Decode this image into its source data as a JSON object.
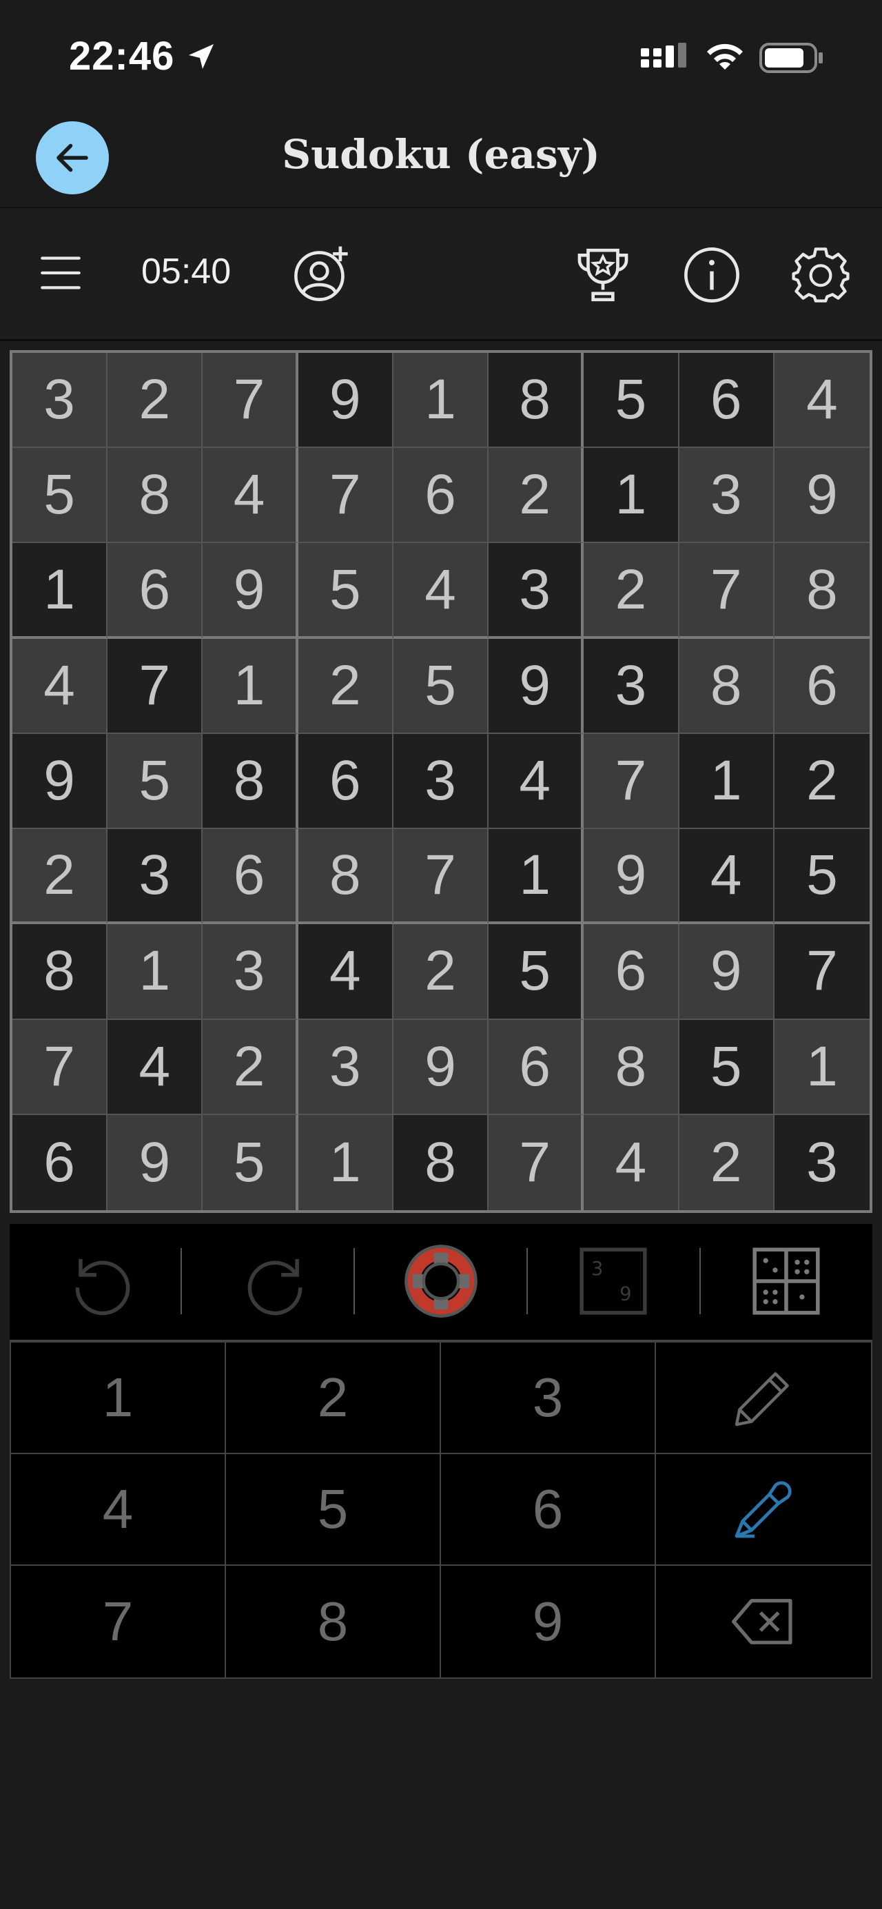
{
  "status": {
    "time": "22:46"
  },
  "header": {
    "title": "Sudoku (easy)"
  },
  "toolbar": {
    "timer": "05:40"
  },
  "colors": {
    "accent": "#8fd1f7",
    "pen_active": "#2a78b0",
    "lifebuoy": "#c0392b"
  },
  "grid": {
    "values": [
      [
        3,
        2,
        7,
        9,
        1,
        8,
        5,
        6,
        4
      ],
      [
        5,
        8,
        4,
        7,
        6,
        2,
        1,
        3,
        9
      ],
      [
        1,
        6,
        9,
        5,
        4,
        3,
        2,
        7,
        8
      ],
      [
        4,
        7,
        1,
        2,
        5,
        9,
        3,
        8,
        6
      ],
      [
        9,
        5,
        8,
        6,
        3,
        4,
        7,
        1,
        2
      ],
      [
        2,
        3,
        6,
        8,
        7,
        1,
        9,
        4,
        5
      ],
      [
        8,
        1,
        3,
        4,
        2,
        5,
        6,
        9,
        7
      ],
      [
        7,
        4,
        2,
        3,
        9,
        6,
        8,
        5,
        1
      ],
      [
        6,
        9,
        5,
        1,
        8,
        7,
        4,
        2,
        3
      ]
    ],
    "shading": [
      "LLLDLDDDL",
      "LLLLLLDLL",
      "DLLLLDLLL",
      "LDLLLDDLL",
      "DLDDDDLDD",
      "LDLLLDLDD",
      "DLLDLDLLD",
      "LDLLLLLDL",
      "DLLLDLLLD"
    ]
  },
  "tools": {
    "items": [
      "undo-icon",
      "redo-icon",
      "hint-lifebuoy-icon",
      "notes-candidates-icon",
      "grid-layout-icon"
    ]
  },
  "keypad": {
    "keys": [
      {
        "label": "1"
      },
      {
        "label": "2"
      },
      {
        "label": "3"
      },
      {
        "icon": "pencil-icon"
      },
      {
        "label": "4"
      },
      {
        "label": "5"
      },
      {
        "label": "6"
      },
      {
        "icon": "pen-icon"
      },
      {
        "label": "7"
      },
      {
        "label": "8"
      },
      {
        "label": "9"
      },
      {
        "icon": "backspace-icon"
      }
    ]
  }
}
